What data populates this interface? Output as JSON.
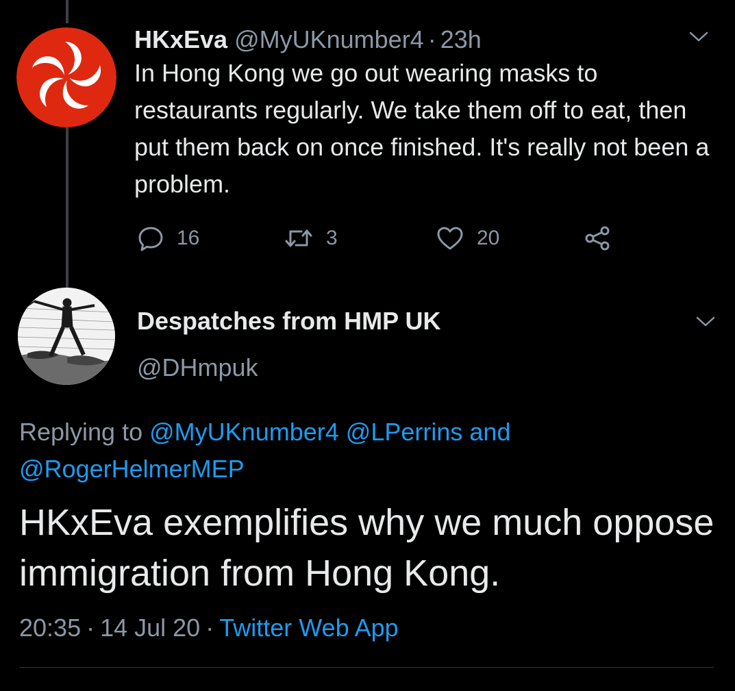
{
  "tweet1": {
    "display_name": "HKxEva",
    "handle": "@MyUKnumber4",
    "separator": "·",
    "time_ago": "23h",
    "text": "In Hong Kong we go out wearing masks to restaurants regularly. We take them off to eat, then put them back on once finished. It's really not been a problem.",
    "avatar_icon": "hong-kong-flag-icon",
    "actions": {
      "reply_count": "16",
      "retweet_count": "3",
      "like_count": "20"
    }
  },
  "tweet2": {
    "display_name": "Despatches from HMP UK",
    "handle": "@DHmpuk",
    "avatar_icon": "engraving-figure-icon",
    "replying_prefix": "Replying to",
    "mention_1": "@MyUKnumber4",
    "mention_2": "@LPerrins",
    "and_word": "and",
    "mention_3": "@RogerHelmerMEP",
    "text": "HKxEva exemplifies why we much oppose immigration from Hong Kong.",
    "time": "20:35",
    "separator": "·",
    "date": "14 Jul 20",
    "source": "Twitter Web App"
  },
  "colors": {
    "background": "#000000",
    "primary_text": "#e7e9ea",
    "secondary_text": "#8b98a5",
    "link": "#1d9bf0",
    "hk_red": "#de2910"
  }
}
